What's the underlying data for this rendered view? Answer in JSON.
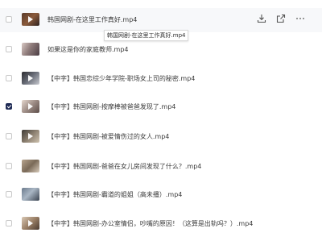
{
  "files": [
    {
      "name": "韩国网剧-在这里工作真好.mp4",
      "checked": false,
      "thumb": "t0"
    },
    {
      "name": "如果这是你的家庭教师.mp4",
      "checked": false,
      "thumb": "t1"
    },
    {
      "name": "【中字】韩国恋综少年学院-职场女上司的秘密.mp4",
      "checked": false,
      "thumb": "t2"
    },
    {
      "name": "【中字】韩国网剧-按摩棒被爸爸发现了.mp4",
      "checked": true,
      "thumb": "t3"
    },
    {
      "name": "【中字】韩国网剧-被爱情伤过的女人.mp4",
      "checked": false,
      "thumb": "t4"
    },
    {
      "name": "【中字】韩国网剧-爸爸在女儿房间发现了什么？.mp4",
      "checked": false,
      "thumb": "t5"
    },
    {
      "name": "【中字】韩国网剧-霸道的姐姐（高未播）.mp4",
      "checked": false,
      "thumb": "t6"
    },
    {
      "name": "【中字】韩国网剧-办公室情侣，吵嘴的原因！（这算是出轨吗？）.mp4",
      "checked": false,
      "thumb": "t7"
    }
  ],
  "tooltip": {
    "text": "韩国网剧-在这里工作真好.mp4"
  },
  "row_actions": {
    "download_icon": "download-icon",
    "share_icon": "share-icon",
    "more_icon": "more-icon"
  },
  "colors": {
    "checkbox_checked": "#1f2b55",
    "hover_row": "#f7f8fa"
  }
}
